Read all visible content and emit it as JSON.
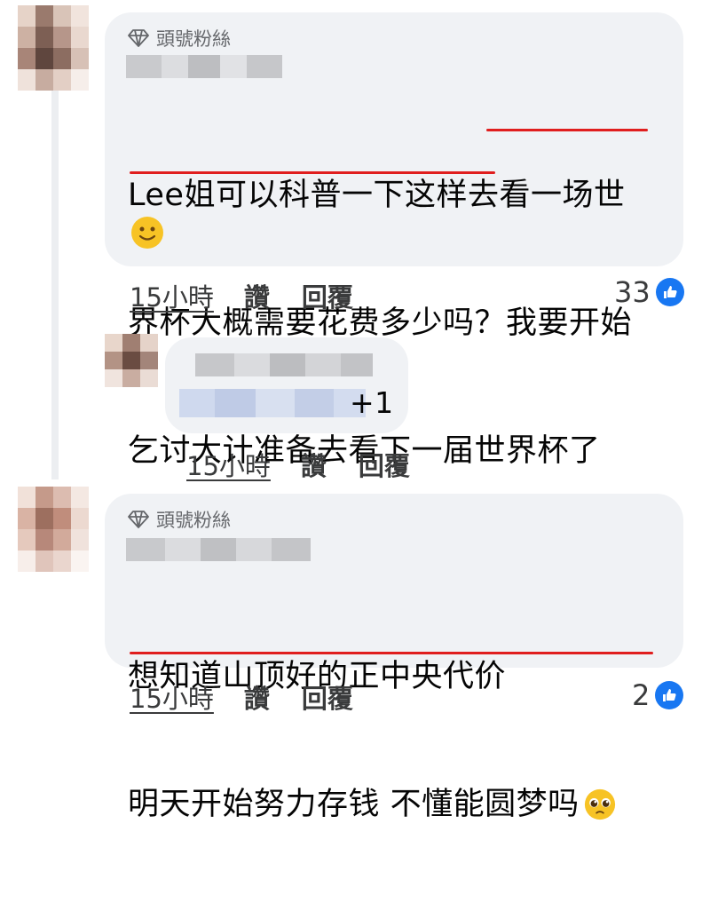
{
  "comments": [
    {
      "badge": "頭號粉絲",
      "lines": [
        "Lee姐可以科普一下这样去看一场世",
        "界杯大概需要花费多少吗？我要开始",
        "乞讨大计准备去看下一届世界杯了"
      ],
      "emoji": "smiling-face",
      "time": "15小時",
      "like": "讚",
      "reply": "回覆",
      "reactions": "33"
    },
    {
      "text": "+1",
      "time": "15小時",
      "like": "讚",
      "reply": "回覆"
    },
    {
      "badge": "頭號粉絲",
      "lines": [
        "想知道山顶好的正中央代价",
        "明天开始努力存钱 不懂能圆梦吗"
      ],
      "emoji": "pleading-face",
      "time": "15小時",
      "like": "讚",
      "reply": "回覆",
      "reactions": "2"
    }
  ],
  "colors": {
    "bubble": "#f0f2f5",
    "underline": "#e01e1e",
    "like": "#1877f2",
    "meta": "#65676b"
  }
}
